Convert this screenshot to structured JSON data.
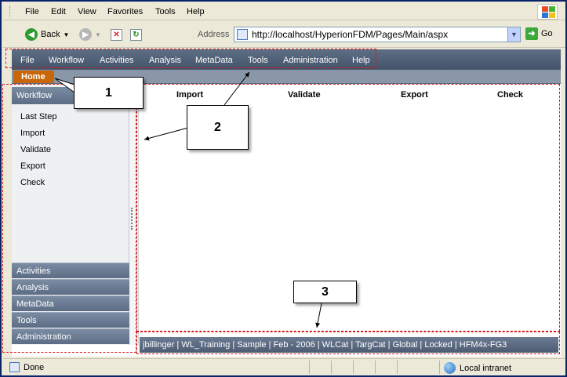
{
  "ie": {
    "menu": [
      "File",
      "Edit",
      "View",
      "Favorites",
      "Tools",
      "Help"
    ],
    "back_label": "Back",
    "address_label": "Address",
    "url": "http://localhost/HyperionFDM/Pages/Main/aspx",
    "go_label": "Go",
    "status_done": "Done",
    "zone": "Local intranet"
  },
  "app": {
    "menu": [
      "File",
      "Workflow",
      "Activities",
      "Analysis",
      "MetaData",
      "Tools",
      "Administration",
      "Help"
    ],
    "home_tab": "Home",
    "sidebar": {
      "header": "Workflow",
      "items": [
        "Last Step",
        "Import",
        "Validate",
        "Export",
        "Check"
      ],
      "sections": [
        "Activities",
        "Analysis",
        "MetaData",
        "Tools",
        "Administration"
      ]
    },
    "steps": [
      "Import",
      "Validate",
      "Export",
      "Check"
    ],
    "status": "jbillinger  |  WL_Training  |  Sample  |  Feb - 2006  |  WLCat  |  TargCat  |  Global  |  Locked  |  HFM4x-FG3"
  },
  "callouts": [
    "1",
    "2",
    "3"
  ],
  "colors": {
    "menu_bar": "#4d5d74",
    "home_tab": "#c8660a",
    "annotation": "#d21c1c"
  }
}
